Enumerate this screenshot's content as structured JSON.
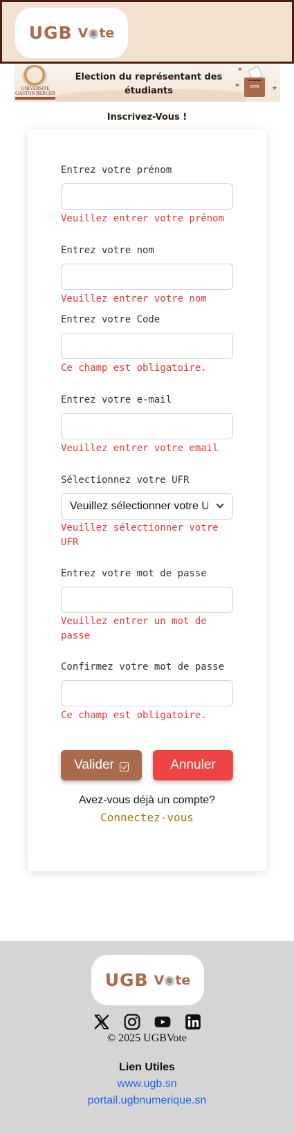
{
  "header": {
    "logo": {
      "text_ugb": "UGB",
      "text_vote_v": "V",
      "text_vote_rest": "te"
    }
  },
  "banner": {
    "university_name": "UNIVERSITE GASTON BERGER",
    "title": "Election du représentant des étudiants",
    "ballot_label": "VOTE"
  },
  "page": {
    "title": "Inscrivez-Vous !"
  },
  "form": {
    "fields": [
      {
        "label": "Entrez votre prénom",
        "value": "",
        "error": "Veuillez entrer votre prénom"
      },
      {
        "label": "Entrez votre nom",
        "value": "",
        "error": "Veuillez entrer votre nom"
      },
      {
        "label": "Entrez votre Code",
        "value": "",
        "error": "Ce champ est obligatoire."
      },
      {
        "label": "Entrez votre e-mail",
        "value": "",
        "error": "Veuillez entrer votre email"
      },
      {
        "label": "Sélectionnez votre UFR",
        "selected": "Veuillez sélectionner votre UFR",
        "error": "Veuillez sélectionner votre UFR"
      },
      {
        "label": "Entrez votre mot de passe",
        "value": "",
        "error": "Veuillez entrer un mot de passe"
      },
      {
        "label": "Confirmez votre mot de passe",
        "value": "",
        "error": "Ce champ est obligatoire."
      }
    ],
    "validate_label": "Valider",
    "cancel_label": "Annuler",
    "account_question": "Avez-vous déjà un compte?",
    "login_link": "Connectez-vous"
  },
  "footer": {
    "logo": {
      "text_ugb": "UGB",
      "text_vote_v": "V",
      "text_vote_rest": "te"
    },
    "socials": [
      "x-icon",
      "instagram-icon",
      "youtube-icon",
      "linkedin-icon"
    ],
    "copyright": "© 2025 UGBVote",
    "links_title": "Lien Utiles",
    "links": [
      "www.ugb.sn",
      "portail.ugbnumerique.sn"
    ]
  },
  "colors": {
    "brand": "#a96a4e",
    "header_bg": "#f3e1cf",
    "header_border": "#4a1d12",
    "error": "#e53935",
    "cancel": "#ef4444",
    "link": "#2563eb",
    "login_link": "#a6730d",
    "footer_bg": "#d5d5d5"
  }
}
